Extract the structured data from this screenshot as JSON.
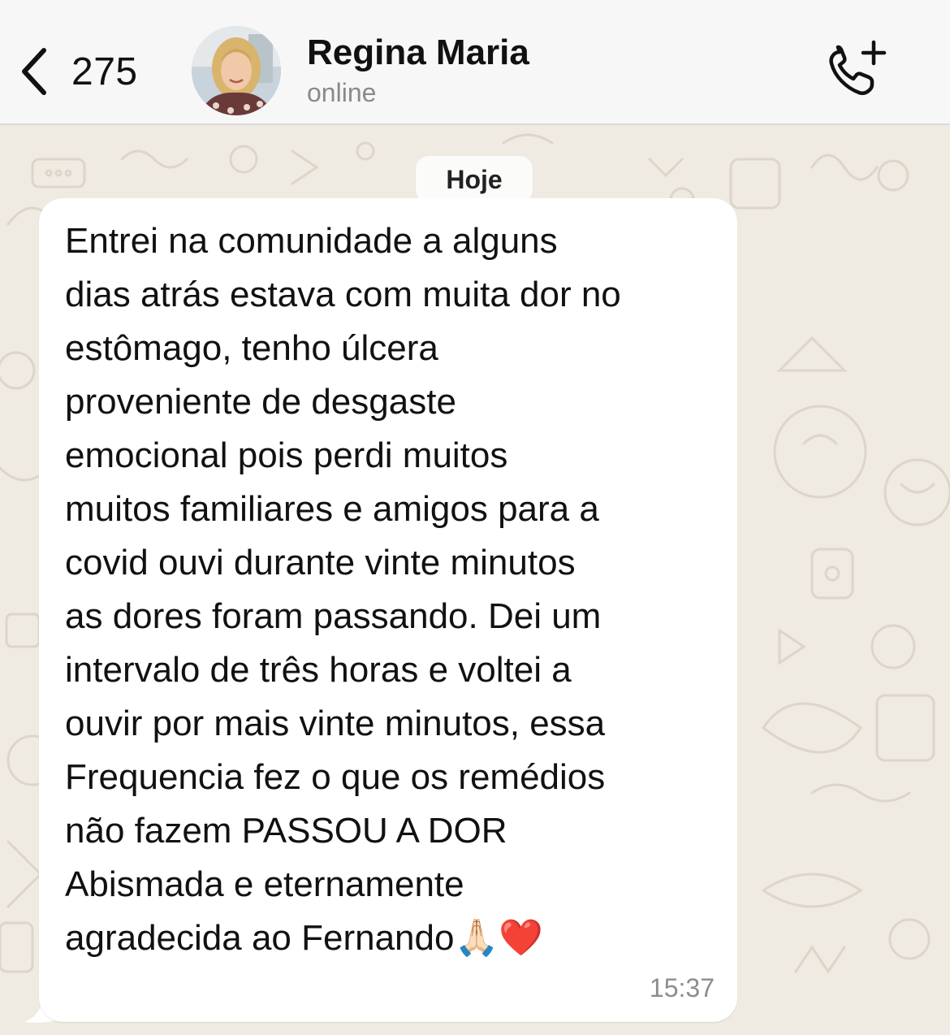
{
  "header": {
    "back_count": "275",
    "contact_name": "Regina Maria",
    "contact_status": "online",
    "avatar_icon": "avatar-photo",
    "call_icon": "add-call-icon"
  },
  "chat": {
    "date_separator": "Hoje",
    "message": {
      "text": "Entrei na comunidade a alguns\ndias atrás estava com muita dor no\nestômago, tenho úlcera\nproveniente de desgaste\nemocional pois perdi muitos\nmuitos familiares e amigos para a\ncovid  ouvi durante vinte minutos\nas dores  foram passando. Dei um\nintervalo de três horas e voltei a\nouvir por mais  vinte minutos, essa\nFrequencia fez o que os remédios\nnão fazem PASSOU A DOR\nAbismada e eternamente\nagradecida  ao Fernando",
      "emojis": "🙏🏻❤️",
      "time": "15:37"
    }
  },
  "colors": {
    "header_bg": "#f7f7f7",
    "chat_bg": "#efeae2",
    "bubble_bg": "#ffffff",
    "status_gray": "#8a8a8a"
  }
}
